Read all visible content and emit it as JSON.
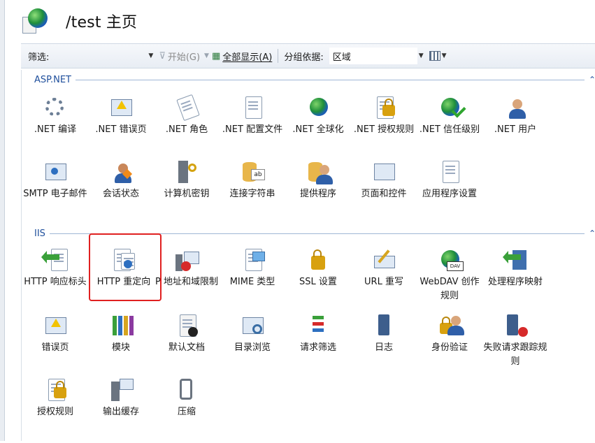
{
  "header": {
    "title": "/test 主页",
    "icon": "iis-site-globe-icon"
  },
  "toolbar": {
    "filter_label": "筛选:",
    "filter_value": "",
    "start_label": "开始(G)",
    "show_all_label": "全部显示(A)",
    "group_by_label": "分组依据:",
    "group_by_value": "区域"
  },
  "sections": {
    "aspnet": {
      "name": "ASP.NET",
      "items": [
        {
          "label": ".NET 编译",
          "icon": "compile-icon"
        },
        {
          "label": ".NET 错误页",
          "icon": "error-page-404-icon"
        },
        {
          "label": ".NET 角色",
          "icon": "roles-icon"
        },
        {
          "label": ".NET 配置文件",
          "icon": "profile-icon"
        },
        {
          "label": ".NET 全球化",
          "icon": "globalization-icon"
        },
        {
          "label": ".NET 授权规则",
          "icon": "authorization-icon"
        },
        {
          "label": ".NET 信任级别",
          "icon": "trust-level-icon"
        },
        {
          "label": ".NET 用户",
          "icon": "users-icon"
        },
        {
          "label": "SMTP 电子邮件",
          "icon": "smtp-email-icon"
        },
        {
          "label": "会话状态",
          "icon": "session-state-icon"
        },
        {
          "label": "计算机密钥",
          "icon": "machine-key-icon"
        },
        {
          "label": "连接字符串",
          "icon": "connection-strings-icon"
        },
        {
          "label": "提供程序",
          "icon": "providers-icon"
        },
        {
          "label": "页面和控件",
          "icon": "pages-controls-icon"
        },
        {
          "label": "应用程序设置",
          "icon": "app-settings-icon"
        }
      ]
    },
    "iis": {
      "name": "IIS",
      "items": [
        {
          "label": "HTTP 响应标头",
          "icon": "http-headers-icon"
        },
        {
          "label": "HTTP 重定向",
          "icon": "http-redirect-icon"
        },
        {
          "label": "P 地址和域限制",
          "icon": "ip-restrictions-icon"
        },
        {
          "label": "MIME 类型",
          "icon": "mime-types-icon"
        },
        {
          "label": "SSL 设置",
          "icon": "ssl-lock-icon"
        },
        {
          "label": "URL 重写",
          "icon": "url-rewrite-icon"
        },
        {
          "label": "WebDAV 创作规则",
          "icon": "webdav-icon"
        },
        {
          "label": "处理程序映射",
          "icon": "handler-mappings-icon"
        },
        {
          "label": "错误页",
          "icon": "error-pages-icon"
        },
        {
          "label": "模块",
          "icon": "modules-icon"
        },
        {
          "label": "默认文档",
          "icon": "default-document-icon"
        },
        {
          "label": "目录浏览",
          "icon": "directory-browsing-icon"
        },
        {
          "label": "请求筛选",
          "icon": "request-filtering-icon"
        },
        {
          "label": "日志",
          "icon": "logging-icon"
        },
        {
          "label": "身份验证",
          "icon": "authentication-icon"
        },
        {
          "label": "失败请求跟踪规则",
          "icon": "failed-request-tracing-icon"
        },
        {
          "label": "授权规则",
          "icon": "authorization-rules-icon"
        },
        {
          "label": "输出缓存",
          "icon": "output-caching-icon"
        },
        {
          "label": "压缩",
          "icon": "compression-icon"
        }
      ]
    }
  }
}
